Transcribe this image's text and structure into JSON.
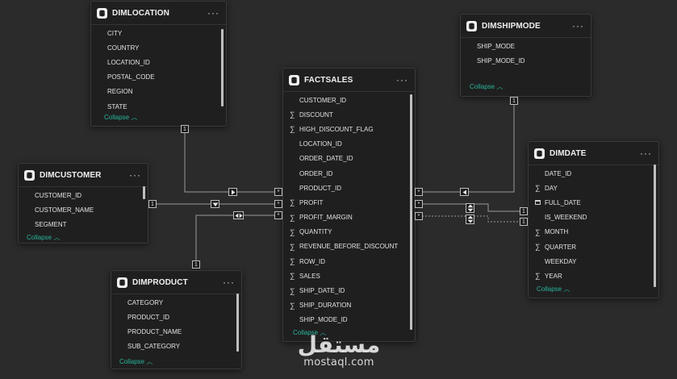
{
  "colors": {
    "background": "#2b2b2b",
    "card": "#1f1f1f",
    "collapse_link": "#27b59b",
    "line": "#9a9a9a"
  },
  "tables": {
    "dimlocation": {
      "title": "DIMLOCATION",
      "more": "···",
      "collapse": "Collapse",
      "fields": [
        {
          "name": "CITY",
          "icon": ""
        },
        {
          "name": "COUNTRY",
          "icon": ""
        },
        {
          "name": "LOCATION_ID",
          "icon": ""
        },
        {
          "name": "POSTAL_CODE",
          "icon": ""
        },
        {
          "name": "REGION",
          "icon": ""
        },
        {
          "name": "STATE",
          "icon": ""
        }
      ]
    },
    "dimshipmode": {
      "title": "DIMSHIPMODE",
      "more": "···",
      "collapse": "Collapse",
      "fields": [
        {
          "name": "SHIP_MODE",
          "icon": ""
        },
        {
          "name": "SHIP_MODE_ID",
          "icon": ""
        }
      ]
    },
    "factsales": {
      "title": "FACTSALES",
      "more": "···",
      "collapse": "Collapse",
      "fields": [
        {
          "name": "CUSTOMER_ID",
          "icon": ""
        },
        {
          "name": "DISCOUNT",
          "icon": "sigma"
        },
        {
          "name": "HIGH_DISCOUNT_FLAG",
          "icon": "sigma"
        },
        {
          "name": "LOCATION_ID",
          "icon": ""
        },
        {
          "name": "ORDER_DATE_ID",
          "icon": ""
        },
        {
          "name": "ORDER_ID",
          "icon": ""
        },
        {
          "name": "PRODUCT_ID",
          "icon": ""
        },
        {
          "name": "PROFIT",
          "icon": "sigma"
        },
        {
          "name": "PROFIT_MARGIN",
          "icon": "sigma"
        },
        {
          "name": "QUANTITY",
          "icon": "sigma"
        },
        {
          "name": "REVENUE_BEFORE_DISCOUNT",
          "icon": "sigma"
        },
        {
          "name": "ROW_ID",
          "icon": "sigma"
        },
        {
          "name": "SALES",
          "icon": "sigma"
        },
        {
          "name": "SHIP_DATE_ID",
          "icon": "sigma"
        },
        {
          "name": "SHIP_DURATION",
          "icon": "sigma"
        },
        {
          "name": "SHIP_MODE_ID",
          "icon": ""
        }
      ]
    },
    "dimcustomer": {
      "title": "DIMCUSTOMER",
      "more": "···",
      "collapse": "Collapse",
      "fields": [
        {
          "name": "CUSTOMER_ID",
          "icon": ""
        },
        {
          "name": "CUSTOMER_NAME",
          "icon": ""
        },
        {
          "name": "SEGMENT",
          "icon": ""
        }
      ]
    },
    "dimdate": {
      "title": "DIMDATE",
      "more": "···",
      "collapse": "Collapse",
      "fields": [
        {
          "name": "DATE_ID",
          "icon": ""
        },
        {
          "name": "DAY",
          "icon": "sigma"
        },
        {
          "name": "FULL_DATE",
          "icon": "calendar"
        },
        {
          "name": "IS_WEEKEND",
          "icon": ""
        },
        {
          "name": "MONTH",
          "icon": "sigma"
        },
        {
          "name": "QUARTER",
          "icon": "sigma"
        },
        {
          "name": "WEEKDAY",
          "icon": ""
        },
        {
          "name": "YEAR",
          "icon": "sigma"
        }
      ]
    },
    "dimproduct": {
      "title": "DIMPRODUCT",
      "more": "···",
      "collapse": "Collapse",
      "fields": [
        {
          "name": "CATEGORY",
          "icon": ""
        },
        {
          "name": "PRODUCT_ID",
          "icon": ""
        },
        {
          "name": "PRODUCT_NAME",
          "icon": ""
        },
        {
          "name": "SUB_CATEGORY",
          "icon": ""
        }
      ]
    }
  },
  "relationships": {
    "one_label": "1",
    "many_label": "*",
    "list": [
      {
        "from": "DIMLOCATION",
        "to": "FACTSALES",
        "cardinality": "1:*",
        "direction": "single"
      },
      {
        "from": "DIMCUSTOMER",
        "to": "FACTSALES",
        "cardinality": "1:*",
        "direction": "single"
      },
      {
        "from": "DIMPRODUCT",
        "to": "FACTSALES",
        "cardinality": "1:*",
        "direction": "both"
      },
      {
        "from": "DIMSHIPMODE",
        "to": "FACTSALES",
        "cardinality": "1:*",
        "direction": "single"
      },
      {
        "from": "DIMDATE",
        "to": "FACTSALES",
        "cardinality": "1:*",
        "direction": "both",
        "status": "active"
      },
      {
        "from": "DIMDATE",
        "to": "FACTSALES",
        "cardinality": "1:*",
        "direction": "both",
        "status": "inactive"
      }
    ]
  },
  "watermark": {
    "arabic": "مستقل",
    "latin": "mostaql.com"
  }
}
